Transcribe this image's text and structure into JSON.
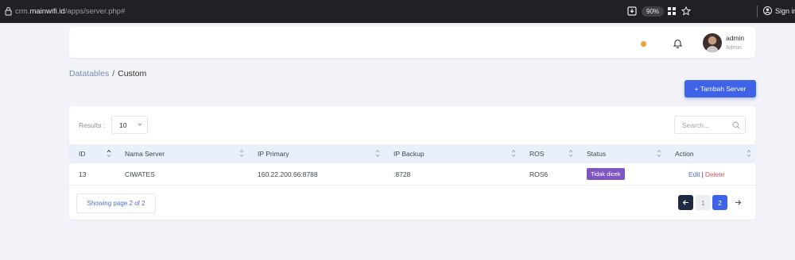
{
  "browser": {
    "url_prefix": "crm.",
    "url_domain": "mainwifi.id",
    "url_path": "/apps/server.php#",
    "zoom": "90%",
    "signin_label": "Sign in"
  },
  "topbar": {
    "user_name": "admin",
    "user_role": "Admin"
  },
  "breadcrumb": {
    "parent": "Datatables",
    "separator": "/",
    "current": "Custom"
  },
  "add_button_label": "+ Tambah Server",
  "controls": {
    "results_label": "Results :",
    "results_value": "10",
    "search_placeholder": "Search..."
  },
  "table": {
    "columns": [
      "ID",
      "Nama Server",
      "IP Primary",
      "IP Backup",
      "ROS",
      "Status",
      "Action"
    ],
    "rows": [
      {
        "id": "13",
        "name": "CIWATES",
        "ip_primary": "160.22.200.66:8788",
        "ip_backup": ":8728",
        "ros": "ROS6",
        "status": "Tidak dicek",
        "edit": "Edit",
        "sep": "|",
        "delete": "Delete"
      }
    ]
  },
  "pagination": {
    "showing": "Showing page 2 of 2",
    "pages": [
      "1",
      "2"
    ],
    "current_page": "2"
  },
  "colors": {
    "accent": "#3e63e8",
    "status_badge": "#7e56c2",
    "delete": "#e0555e",
    "notification_dot": "#e9a23b"
  }
}
